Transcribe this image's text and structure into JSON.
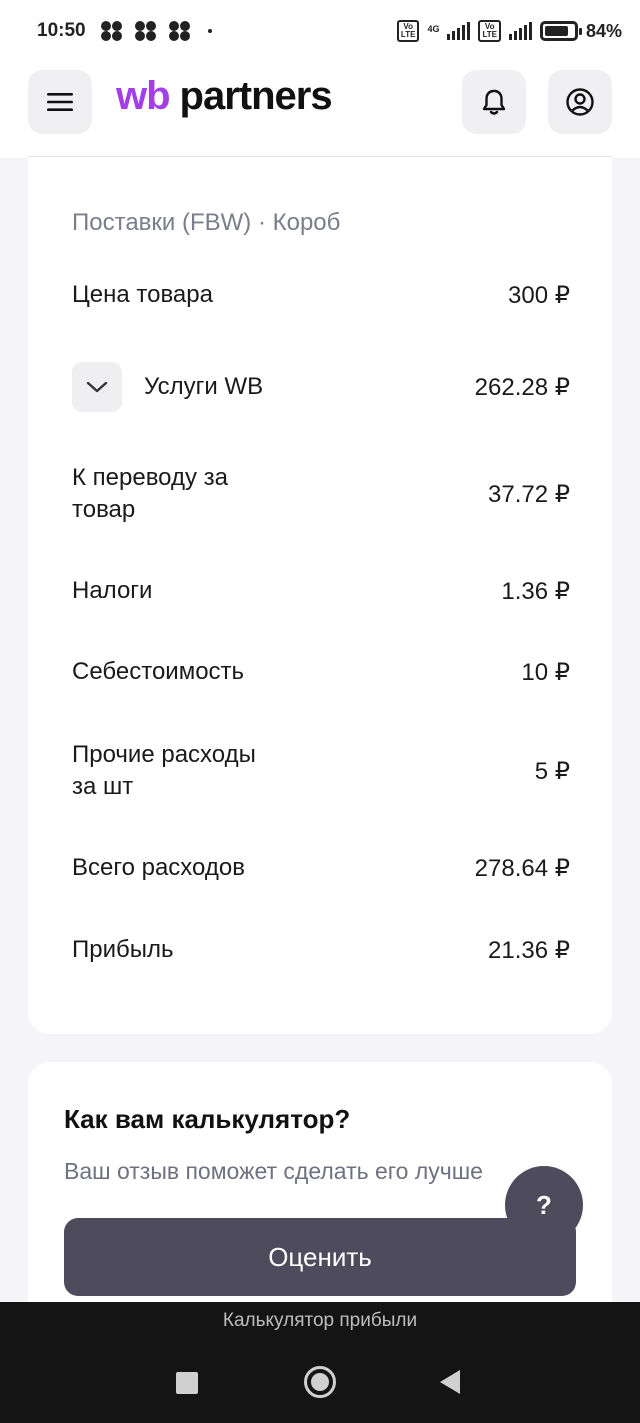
{
  "status_bar": {
    "time": "10:50",
    "battery": "84%",
    "battery_level": 0.84,
    "network": "4G"
  },
  "header": {
    "logo_prefix": "wb",
    "logo_suffix": "partners",
    "icons": {
      "menu": "menu-icon",
      "bell": "bell-icon",
      "profile": "profile-icon"
    },
    "accent_color": "#a33ee8"
  },
  "result": {
    "subtitle": "Поставки (FBW) · Короб",
    "rows": [
      {
        "label": "Цена товара",
        "value": "300 ₽"
      },
      {
        "label": "Услуги WB",
        "value": "262.28 ₽",
        "expandable": true
      },
      {
        "label": "К переводу за товар",
        "value": "37.72 ₽"
      },
      {
        "label": "Налоги",
        "value": "1.36 ₽"
      },
      {
        "label": "Себестоимость",
        "value": "10 ₽"
      },
      {
        "label": "Прочие расходы за шт",
        "value": "5 ₽"
      },
      {
        "label": "Всего расходов",
        "value": "278.64 ₽"
      },
      {
        "label": "Прибыль",
        "value": "21.36 ₽"
      }
    ]
  },
  "feedback": {
    "title": "Как вам калькулятор?",
    "subtitle": "Ваш отзыв поможет сделать его лучше",
    "button_label": "Оценить",
    "button_color": "#4d4b5c"
  },
  "help": {
    "label": "?"
  },
  "system_bar": {
    "caption": "Калькулятор прибыли"
  }
}
